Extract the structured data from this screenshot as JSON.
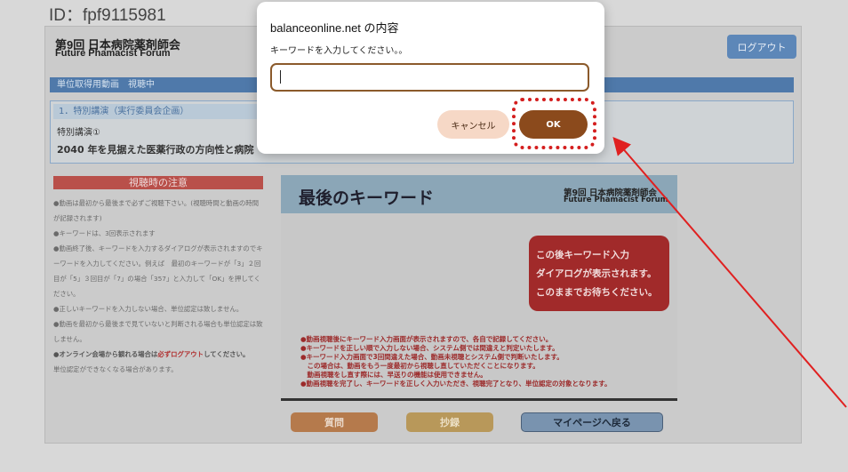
{
  "page": {
    "user_id": "ID：fpf9115981",
    "header_title_jp": "第9回 日本病院薬剤師会",
    "header_title_en": "Future Phamacist Forum",
    "logout_label": "ログアウト",
    "section_label": "単位取得用動画　視聴中",
    "lecture_category": "1．特別講演（実行委員会企画）",
    "lecture_sub": "特別講演①",
    "lecture_title": "2040 年を見据えた医薬行政の方向性と病院"
  },
  "notice": {
    "heading": "視聴時の注意",
    "items": [
      "●動画は最初から最後まで必ずご視聴下さい。(視聴時間と動画の時間が記録されます)",
      "●キーワードは、3回表示されます",
      "●動画終了後、キーワードを入力するダイアログが表示されますのでキーワードを入力してください。例えば　最初のキーワードが「3」２回目が「5」３回目が「7」の場合「357」と入力して「OK」を押してください。",
      "●正しいキーワードを入力しない場合、単位認定は致しません。",
      "●動画を最初から最後まで見ていないと判断される場合も単位認定は致しません。"
    ],
    "online_item_prefix": "●オンライン会場から観れる場合は",
    "online_item_warn": "必ずログアウト",
    "online_item_suffix": "してください。",
    "last_item": "単位認定ができなくなる場合があります。"
  },
  "slide": {
    "title": "最後のキーワード",
    "brand_jp": "第9回 日本病院薬剤師会",
    "brand_en": "Future Phamacist Forum",
    "callout": [
      "この後キーワード入力",
      "ダイアログが表示されます。",
      "このままでお待ちください。"
    ],
    "notes": [
      "●動画視聴後にキーワード入力画面が表示されますので、各自で記録してください。",
      "●キーワードを正しい順で入力しない場合、システム側では間違えと判定いたします。",
      "●キーワード入力画面で3回間違えた場合、動画未視聴とシステム側で判断いたします。",
      "　この場合は、動画をもう一度最初から視聴し直していただくことになります。",
      "　動画視聴をし直す際には、早送りの機能は使用できません。",
      "●動画視聴を完了し、キーワードを正しく入力いただき、視聴完了となり、単位認定の対象となります。"
    ]
  },
  "buttons": {
    "question": "質問",
    "copy": "抄録",
    "mypage": "マイページへ戻る"
  },
  "dialog": {
    "title": "balanceonline.net の内容",
    "message": "キーワードを入力してください。。",
    "input_value": "",
    "cancel_label": "キャンセル",
    "ok_label": "OK"
  },
  "annotation": {
    "highlight_color": "#d41e1e",
    "arrow_color": "#e02020"
  }
}
